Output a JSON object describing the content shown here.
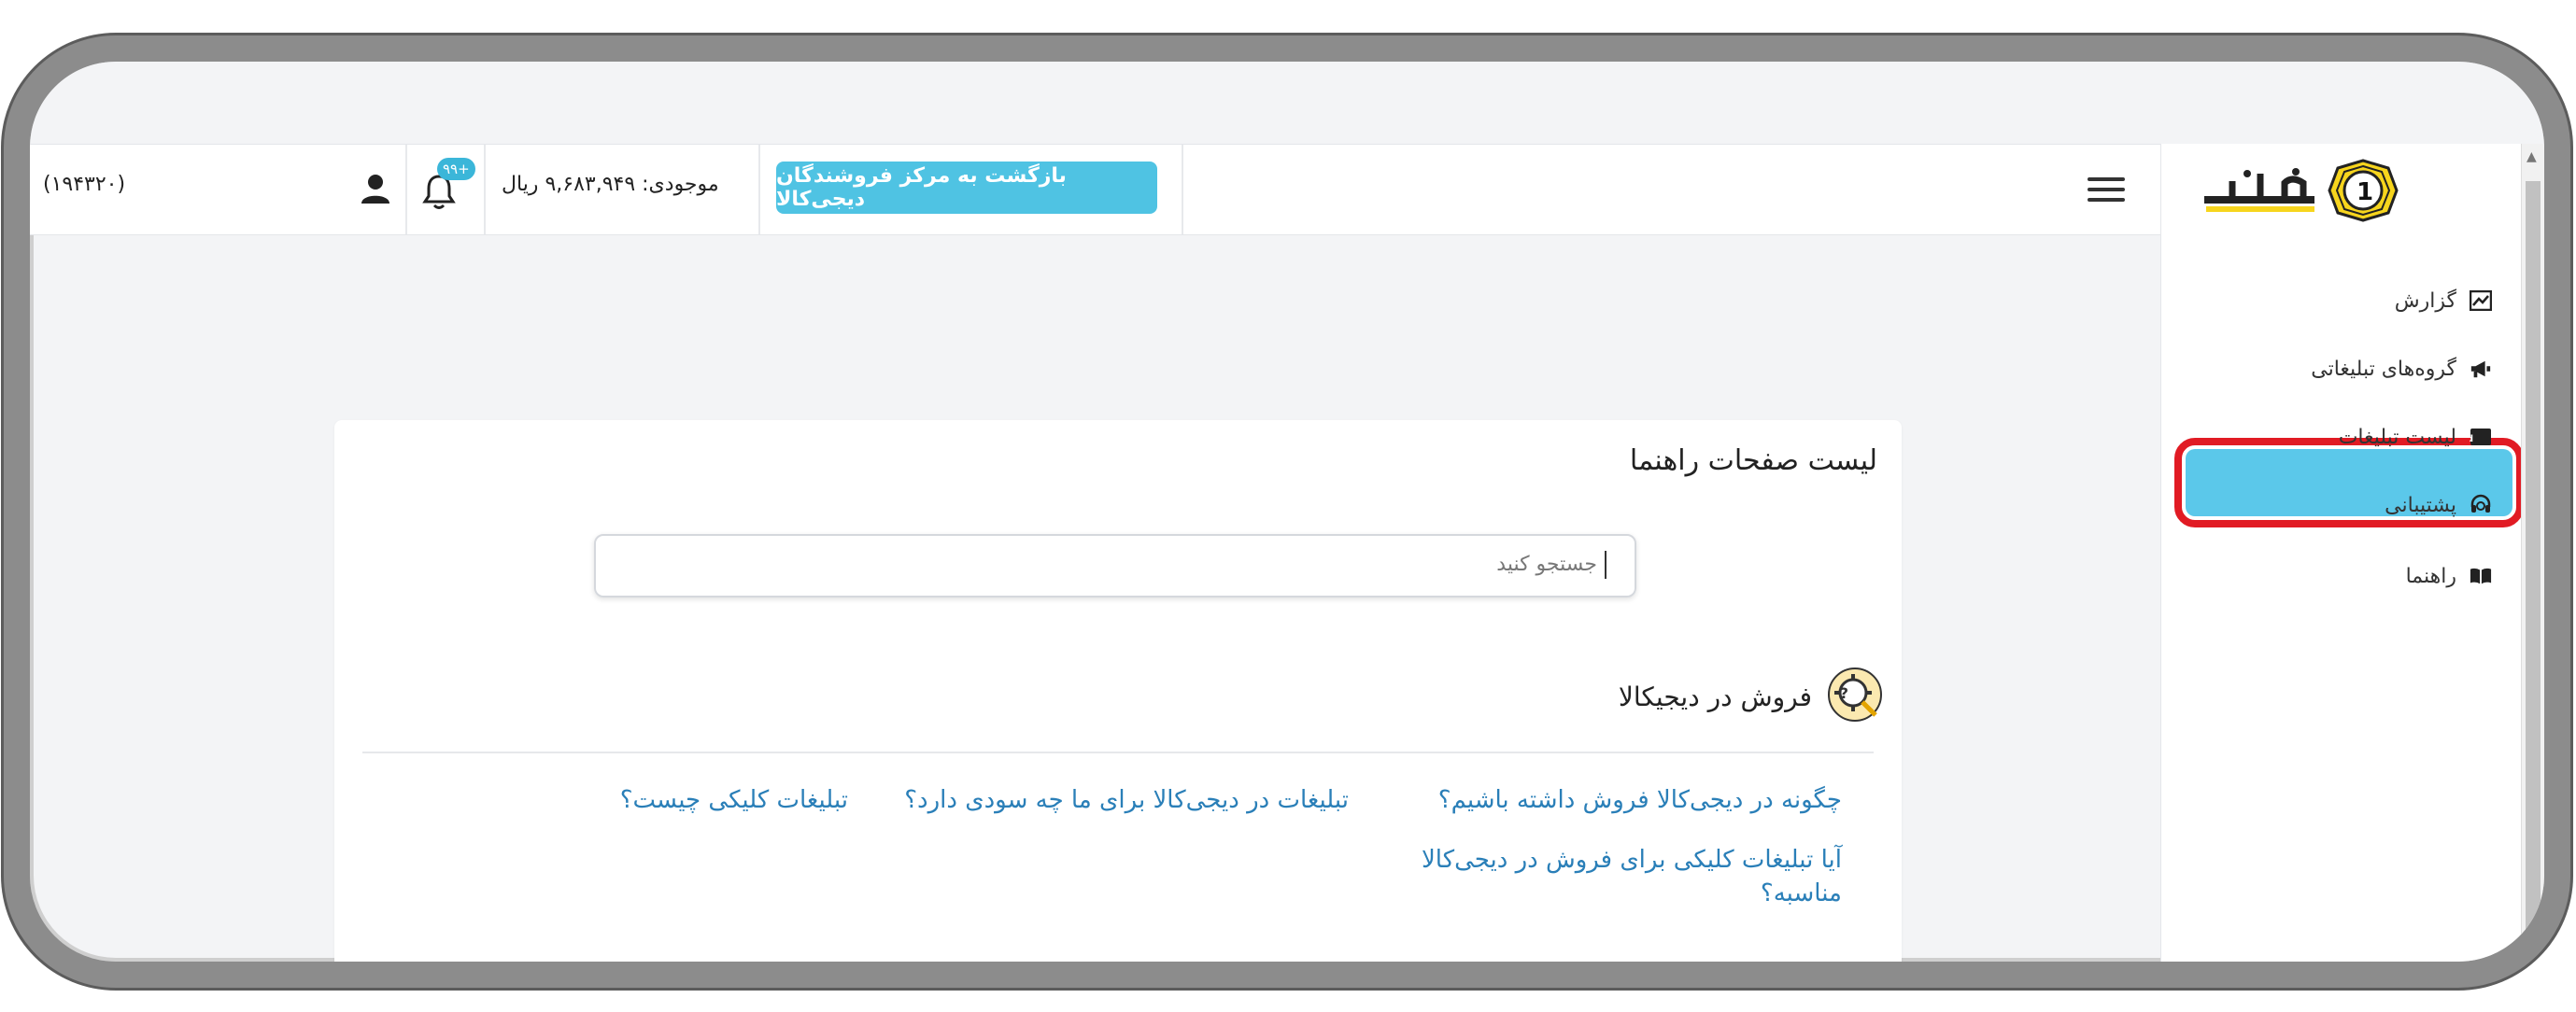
{
  "header": {
    "code": "(۱۹۴۳۲۰)",
    "notification_badge": "۹۹+",
    "balance": "موجودی: ۹,۶۸۳,۹۴۹ ریال",
    "back_button": "بازگشت به مرکز فروشندگان دیجی‌کالا"
  },
  "sidebar": {
    "items": [
      {
        "label": "گزارش",
        "icon": "chart-icon"
      },
      {
        "label": "گروه‌های تبلیغاتی",
        "icon": "megaphone-icon"
      },
      {
        "label": "لیست تبلیغات",
        "icon": "ad-icon"
      },
      {
        "label": "پشتیبانی",
        "icon": "headset-icon"
      },
      {
        "label": "راهنما",
        "icon": "book-icon",
        "active": true
      }
    ]
  },
  "main": {
    "title": "لیست صفحات راهنما",
    "search_placeholder": "جستجو کنید",
    "section_title": "فروش در دیجیکالا",
    "links": [
      "چگونه در دیجی‌کالا فروش داشته باشیم؟",
      "تبلیغات در دیجی‌کالا برای ما چه سودی دارد؟",
      "تبلیغات کلیکی چیست؟",
      "آیا تبلیغات کلیکی برای فروش در دیجی‌کالا",
      "مناسبه؟"
    ]
  },
  "colors": {
    "accent": "#4fc3e3",
    "highlight": "#e11b24",
    "link": "#2a7fb8"
  }
}
